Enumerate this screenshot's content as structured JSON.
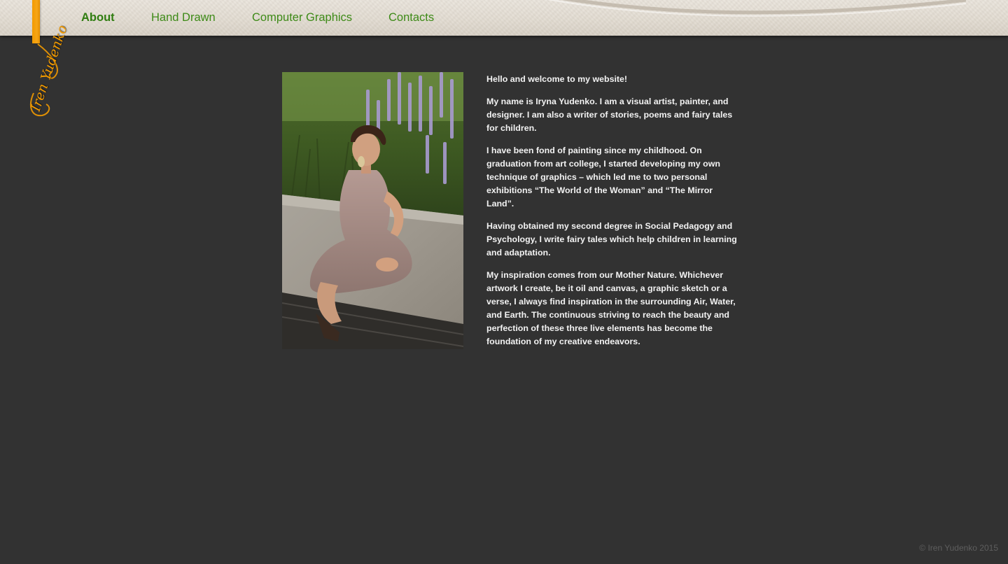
{
  "nav": {
    "items": [
      {
        "label": "About",
        "active": true
      },
      {
        "label": "Hand Drawn",
        "active": false
      },
      {
        "label": "Computer Graphics",
        "active": false
      },
      {
        "label": "Contacts",
        "active": false
      }
    ]
  },
  "logo": {
    "signature": "Iren Yudenko"
  },
  "main": {
    "paragraphs": [
      "Hello and welcome to my website!",
      "My name is Iryna Yudenko. I am a visual artist, painter, and designer. I am also a writer of stories, poems and fairy tales for children.",
      "I have been fond of painting since my childhood. On graduation from art college, I started developing my own technique of graphics – which led me to two personal exhibitions “The World of the Woman” and “The Mirror Land”.",
      "Having obtained my second degree in Social Pedagogy and Psychology, I write fairy tales which help children in learning and adaptation.",
      "My inspiration comes from our Mother Nature. Whichever artwork I create, be it oil and canvas, a graphic sketch or a verse, I always find inspiration in the surrounding Air, Water, and Earth. The continuous striving to reach the beauty and perfection of these three live elements has become the foundation of my creative endeavors."
    ]
  },
  "footer": {
    "copyright": "© Iren Yudenko 2015"
  },
  "colors": {
    "background": "#323232",
    "nav_text": "#3d8a17",
    "accent_orange": "#f29a00",
    "body_text": "#f2f2f2",
    "footer_text": "#5e5e5e"
  }
}
